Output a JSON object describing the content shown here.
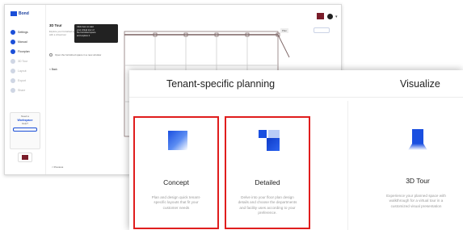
{
  "back_window": {
    "app_name": "Bond",
    "nav_items": [
      {
        "label": "Settings",
        "active": true
      },
      {
        "label": "Manual",
        "active": true
      },
      {
        "label": "Floorplan",
        "active": true
      },
      {
        "label": "3D Tour",
        "active": false
      },
      {
        "label": "Layout",
        "active": false
      },
      {
        "label": "Export",
        "active": false
      },
      {
        "label": "Share",
        "active": false
      }
    ],
    "tour_title": "3D Tour",
    "tour_desc": "Explore your furnished space with a virtual tour",
    "tooltip_lines": [
      "Click here to start",
      "your virtual tour of",
      "the furnished space",
      "and explore it"
    ],
    "link_text": "Open the furnished space in a new window",
    "back_link": "< Back",
    "side_card_lines": [
      "Need a",
      "Workspace",
      "Help?"
    ],
    "footer_text": "< Previous",
    "plan_tag": "Plan",
    "colors": {
      "accent": "#1b4fd8",
      "brand": "#7a1d2a"
    }
  },
  "front_window": {
    "section_titles": {
      "tenant": "Tenant-specific planning",
      "visualize": "Visualize"
    },
    "cards": [
      {
        "label": "Concept",
        "description": "Plan and design quick tenant-specific layouts that fit your customer needs",
        "highlighted": true,
        "icon": "concept-icon"
      },
      {
        "label": "Detailed",
        "description": "Delve into your floor plan design details and choose the departments and facility uses according to your preference.",
        "highlighted": true,
        "icon": "detailed-icon"
      },
      {
        "label": "3D Tour",
        "description": "Experience your planned space with walkthrough for a virtual tour in a customized visual presentation",
        "highlighted": false,
        "icon": "3d-tour-icon"
      }
    ],
    "colors": {
      "highlight": "#e01d1d",
      "icon_blue": "#1a4fe0"
    }
  }
}
